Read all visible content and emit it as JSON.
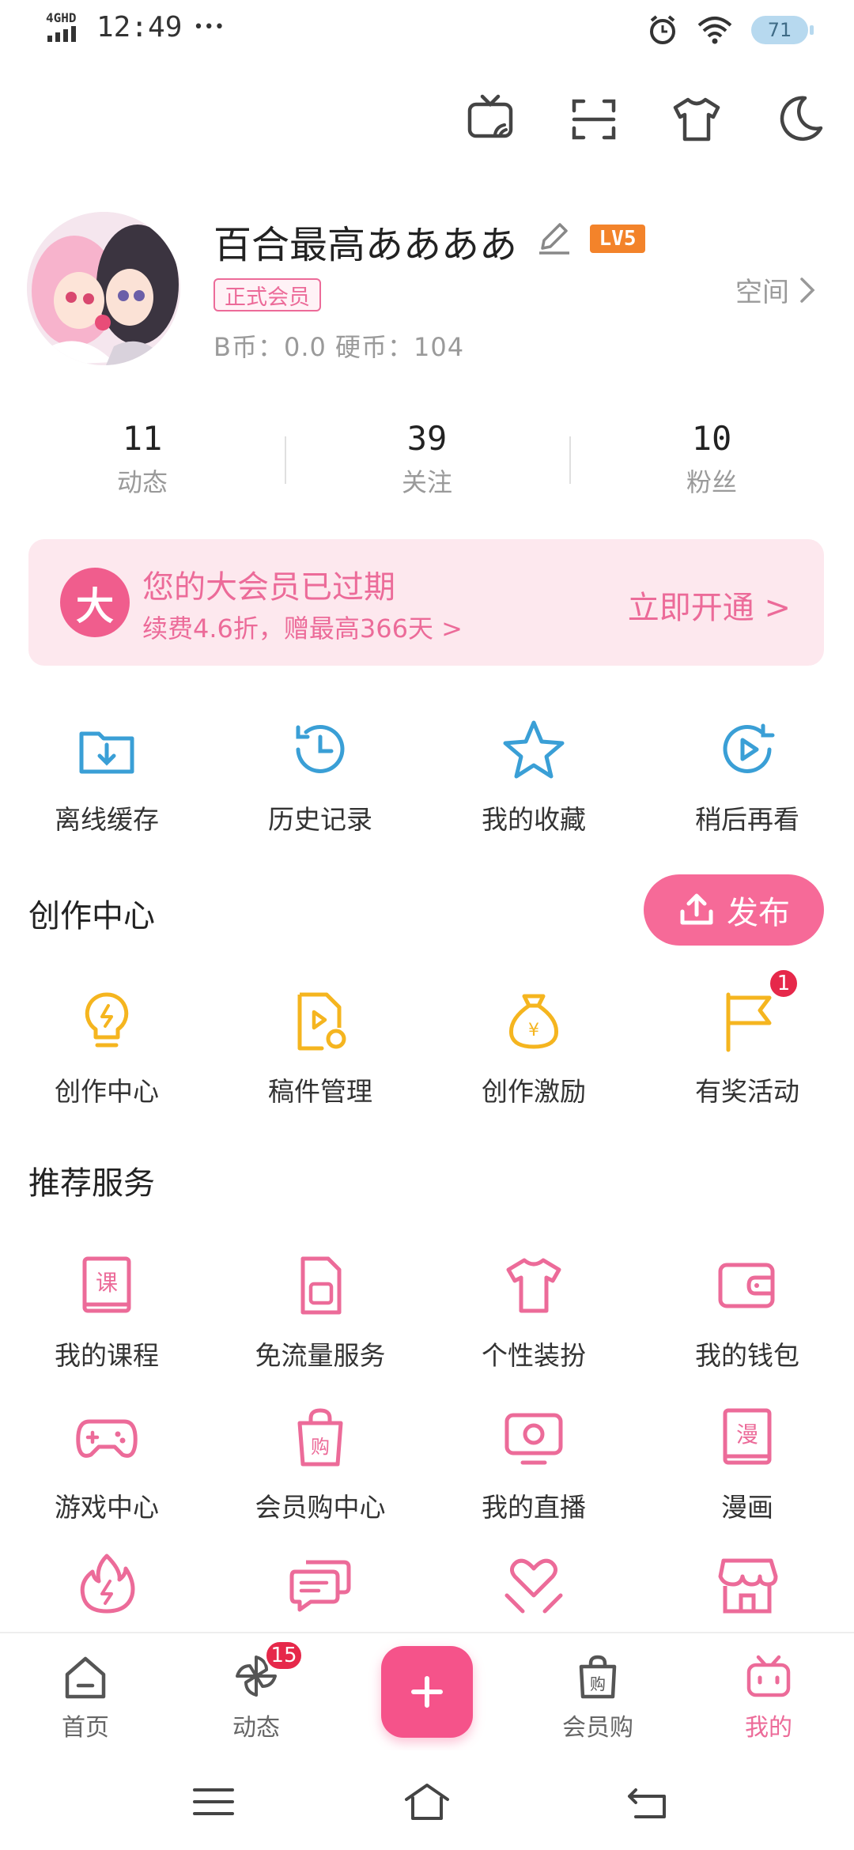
{
  "status_bar": {
    "network": "4GHD",
    "time": "12:49",
    "more": "•••",
    "battery": "71"
  },
  "top_icons": [
    "tv-cast-icon",
    "scan-icon",
    "shirt-icon",
    "moon-icon"
  ],
  "profile": {
    "username": "百合最高ああああ",
    "level": "LV5",
    "vip_tag": "正式会员",
    "coins": "B币：0.0   硬币：104",
    "space_label": "空间"
  },
  "stats": [
    {
      "value": "11",
      "label": "动态"
    },
    {
      "value": "39",
      "label": "关注"
    },
    {
      "value": "10",
      "label": "粉丝"
    }
  ],
  "vip_banner": {
    "logo": "大",
    "title": "您的大会员已过期",
    "subtitle": "续费4.6折，赠最高366天 >",
    "action": "立即开通 >"
  },
  "quick_actions": [
    {
      "label": "离线缓存",
      "icon": "download-folder-icon"
    },
    {
      "label": "历史记录",
      "icon": "history-clock-icon"
    },
    {
      "label": "我的收藏",
      "icon": "star-icon"
    },
    {
      "label": "稍后再看",
      "icon": "play-later-icon"
    }
  ],
  "creation": {
    "title": "创作中心",
    "publish_label": "发布",
    "items": [
      {
        "label": "创作中心",
        "icon": "lightbulb-icon",
        "badge": ""
      },
      {
        "label": "稿件管理",
        "icon": "manuscript-icon",
        "badge": ""
      },
      {
        "label": "创作激励",
        "icon": "money-bag-icon",
        "badge": ""
      },
      {
        "label": "有奖活动",
        "icon": "flag-icon",
        "badge": "1"
      }
    ]
  },
  "services": {
    "title": "推荐服务",
    "rows": [
      [
        {
          "label": "我的课程",
          "icon": "course-book-icon"
        },
        {
          "label": "免流量服务",
          "icon": "sim-card-icon"
        },
        {
          "label": "个性装扮",
          "icon": "tshirt-icon"
        },
        {
          "label": "我的钱包",
          "icon": "wallet-icon"
        }
      ],
      [
        {
          "label": "游戏中心",
          "icon": "gamepad-icon"
        },
        {
          "label": "会员购中心",
          "icon": "shopping-bag-icon"
        },
        {
          "label": "我的直播",
          "icon": "live-tv-icon"
        },
        {
          "label": "漫画",
          "icon": "comic-book-icon"
        }
      ],
      [
        {
          "label": "",
          "icon": "flame-icon"
        },
        {
          "label": "",
          "icon": "chat-bubbles-icon"
        },
        {
          "label": "",
          "icon": "heart-hands-icon"
        },
        {
          "label": "",
          "icon": "store-icon"
        }
      ]
    ]
  },
  "tabbar": {
    "items": [
      {
        "label": "首页",
        "icon": "home-icon",
        "badge": ""
      },
      {
        "label": "动态",
        "icon": "pinwheel-icon",
        "badge": "15"
      },
      {
        "label": "",
        "icon": "plus-icon",
        "badge": ""
      },
      {
        "label": "会员购",
        "icon": "shopping-bag-icon",
        "badge": ""
      },
      {
        "label": "我的",
        "icon": "bilibili-tv-icon",
        "badge": ""
      }
    ],
    "active": "我的"
  },
  "colors": {
    "accent": "#f66a98",
    "vip_bg": "#fde8ee",
    "creator_icon": "#f5b51f",
    "service_icon": "#ec6b99",
    "quick_icon": "#3a9fd6",
    "badge": "#e6284a"
  }
}
